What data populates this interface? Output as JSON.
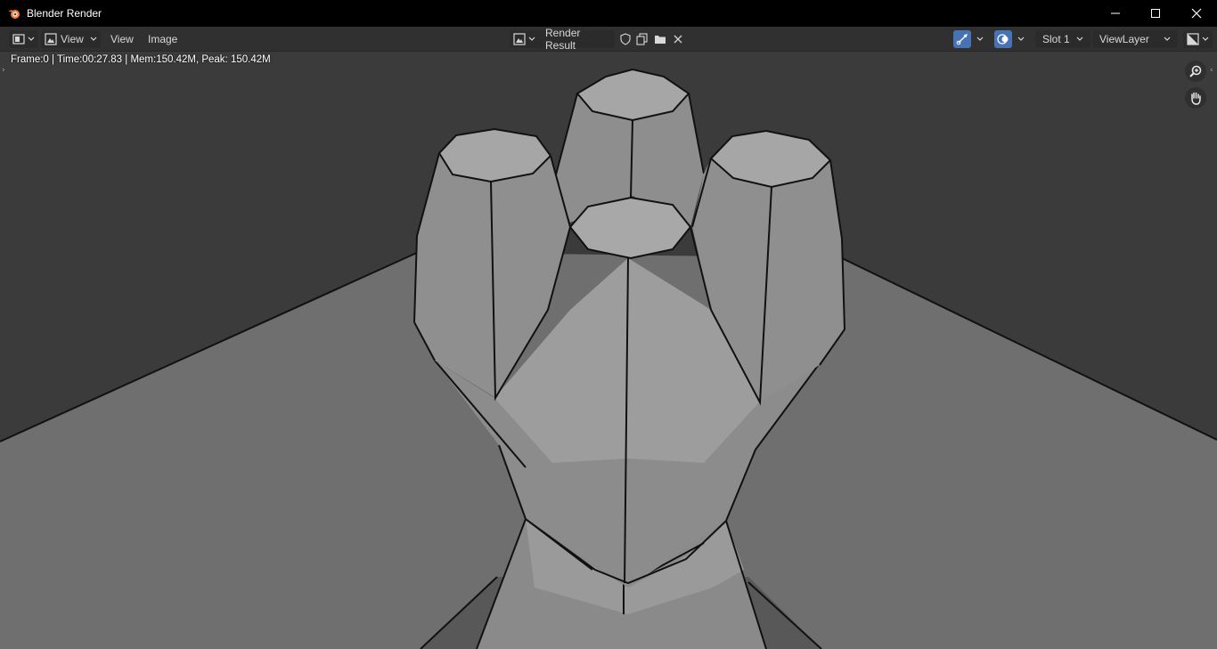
{
  "window": {
    "title": "Blender Render"
  },
  "header": {
    "editor_type_icon": "image-editor-icon",
    "view_mode_icon": "image-icon",
    "view_mode_label": "View",
    "menus": [
      "View",
      "Image"
    ],
    "image_browse_icon": "image-browse-icon",
    "image_name": "Render Result",
    "slot": "Slot 1",
    "view_layer": "ViewLayer"
  },
  "viewport": {
    "stats": "Frame:0 | Time:00:27.83 | Mem:150.42M, Peak: 150.42M"
  },
  "colors": {
    "accent": "#4772b3",
    "background": "#303030",
    "titlebar": "#000000"
  }
}
